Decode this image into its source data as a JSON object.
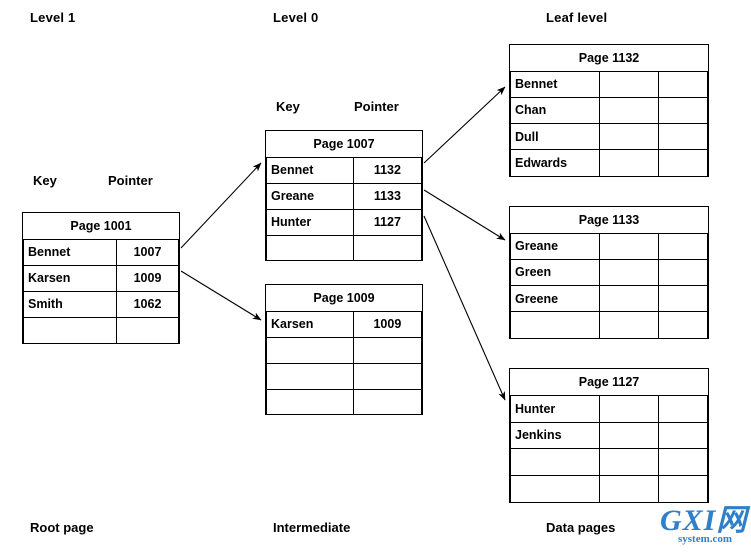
{
  "diagram": {
    "title_labels": {
      "level1": "Level 1",
      "level0": "Level 0",
      "leaf": "Leaf level"
    },
    "footer_labels": {
      "root": "Root page",
      "intermediate": "Intermediate",
      "data": "Data pages"
    },
    "column_headers": {
      "root_key": "Key",
      "root_pointer": "Pointer",
      "level0_key": "Key",
      "level0_pointer": "Pointer"
    },
    "colors": {
      "ink": "#000000",
      "background": "#ffffff",
      "watermark": "#2f7fc9"
    }
  },
  "root_page": {
    "title": "Page 1001",
    "rows": [
      {
        "key": "Bennet",
        "pointer": "1007"
      },
      {
        "key": "Karsen",
        "pointer": "1009"
      },
      {
        "key": "Smith",
        "pointer": "1062"
      },
      {
        "key": "",
        "pointer": ""
      }
    ]
  },
  "intermediate_pages": [
    {
      "title": "Page 1007",
      "rows": [
        {
          "key": "Bennet",
          "pointer": "1132"
        },
        {
          "key": "Greane",
          "pointer": "1133"
        },
        {
          "key": "Hunter",
          "pointer": "1127"
        },
        {
          "key": "",
          "pointer": ""
        }
      ]
    },
    {
      "title": "Page 1009",
      "rows": [
        {
          "key": "Karsen",
          "pointer": "1009"
        },
        {
          "key": "",
          "pointer": ""
        },
        {
          "key": "",
          "pointer": ""
        },
        {
          "key": "",
          "pointer": ""
        }
      ]
    }
  ],
  "leaf_pages": [
    {
      "title": "Page 1132",
      "rows": [
        {
          "key": "Bennet",
          "col2": "",
          "col3": ""
        },
        {
          "key": "Chan",
          "col2": "",
          "col3": ""
        },
        {
          "key": "Dull",
          "col2": "",
          "col3": ""
        },
        {
          "key": "Edwards",
          "col2": "",
          "col3": ""
        }
      ]
    },
    {
      "title": "Page 1133",
      "rows": [
        {
          "key": "Greane",
          "col2": "",
          "col3": ""
        },
        {
          "key": "Green",
          "col2": "",
          "col3": ""
        },
        {
          "key": "Greene",
          "col2": "",
          "col3": ""
        },
        {
          "key": "",
          "col2": "",
          "col3": ""
        }
      ]
    },
    {
      "title": "Page 1127",
      "rows": [
        {
          "key": "Hunter",
          "col2": "",
          "col3": ""
        },
        {
          "key": "Jenkins",
          "col2": "",
          "col3": ""
        },
        {
          "key": "",
          "col2": "",
          "col3": ""
        },
        {
          "key": "",
          "col2": "",
          "col3": ""
        }
      ]
    }
  ],
  "watermark": {
    "main": "GXI网",
    "sub": "system.com"
  }
}
